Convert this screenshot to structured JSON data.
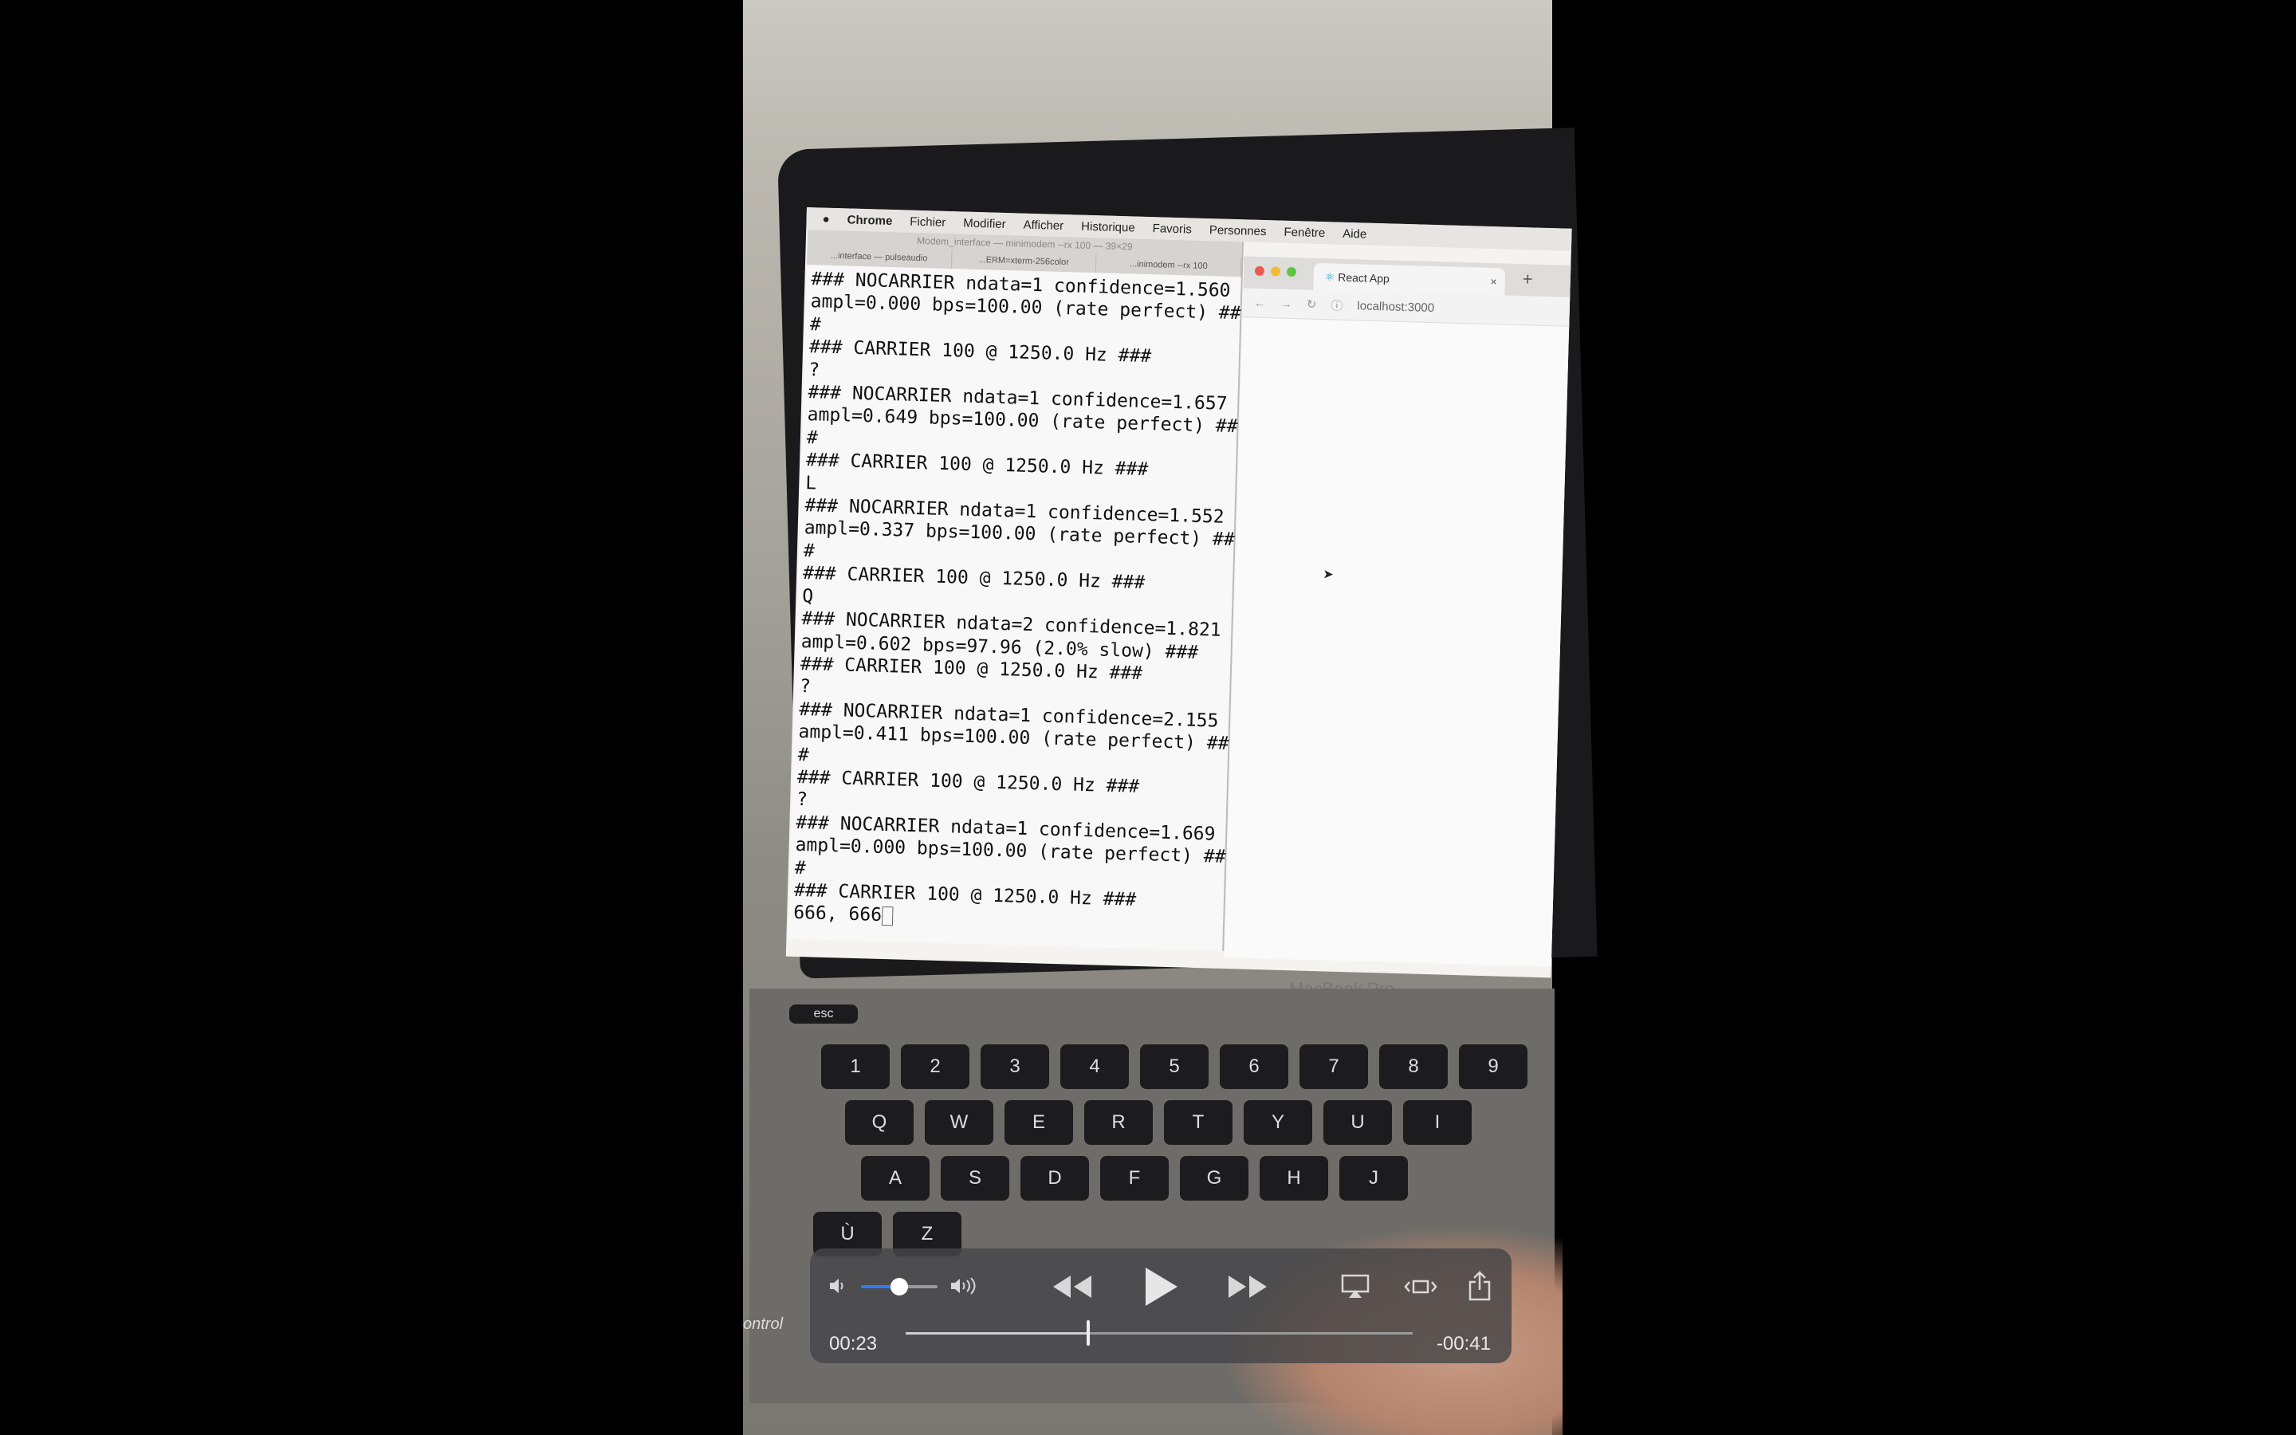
{
  "menubar": {
    "brand": "Chrome",
    "items": [
      "Fichier",
      "Modifier",
      "Afficher",
      "Historique",
      "Favoris",
      "Personnes",
      "Fenêtre",
      "Aide"
    ]
  },
  "terminal": {
    "title": "Modem_interface — minimodem --rx 100 — 39×29",
    "tabs": [
      "...interface — pulseaudio",
      "...ERM=xterm-256color",
      "...inimodem --rx 100"
    ],
    "lines": [
      "### NOCARRIER ndata=1 confidence=1.560",
      "ampl=0.000 bps=100.00 (rate perfect) ##",
      "#",
      "### CARRIER 100 @ 1250.0 Hz ###",
      "?",
      "### NOCARRIER ndata=1 confidence=1.657",
      "ampl=0.649 bps=100.00 (rate perfect) ##",
      "#",
      "### CARRIER 100 @ 1250.0 Hz ###",
      "L",
      "### NOCARRIER ndata=1 confidence=1.552",
      "ampl=0.337 bps=100.00 (rate perfect) ##",
      "#",
      "### CARRIER 100 @ 1250.0 Hz ###",
      "Q",
      "### NOCARRIER ndata=2 confidence=1.821",
      "ampl=0.602 bps=97.96 (2.0% slow) ###",
      "### CARRIER 100 @ 1250.0 Hz ###",
      "?",
      "### NOCARRIER ndata=1 confidence=2.155",
      "ampl=0.411 bps=100.00 (rate perfect) ##",
      "#",
      "### CARRIER 100 @ 1250.0 Hz ###",
      "?",
      "### NOCARRIER ndata=1 confidence=1.669",
      "ampl=0.000 bps=100.00 (rate perfect) ##",
      "#",
      "### CARRIER 100 @ 1250.0 Hz ###",
      "666, 666"
    ]
  },
  "browser": {
    "tab_title": "React App",
    "tab_close": "×",
    "new_tab": "+",
    "url": "localhost:3000"
  },
  "laptop": {
    "model": "MacBook Pro"
  },
  "keyboard": {
    "row1": [
      "esc"
    ],
    "row2": [
      "1",
      "2",
      "3",
      "4",
      "5",
      "6",
      "7",
      "8",
      "9"
    ],
    "row3": [
      "Q",
      "W",
      "E",
      "R",
      "T",
      "Y",
      "U",
      "I"
    ],
    "row4": [
      "A",
      "S",
      "D",
      "F",
      "G",
      "H",
      "J"
    ],
    "row5": [
      "Ù",
      "Z"
    ],
    "side": "ontrol"
  },
  "player": {
    "elapsed": "00:23",
    "remaining": "-00:41",
    "volume_level": 0.5,
    "progress": 0.36,
    "icons": [
      "volume-low-icon",
      "volume-high-icon",
      "rewind-icon",
      "play-icon",
      "fast-forward-icon",
      "airplay-icon",
      "aspect-ratio-icon",
      "share-icon"
    ],
    "accent": "#2f7cf6"
  }
}
